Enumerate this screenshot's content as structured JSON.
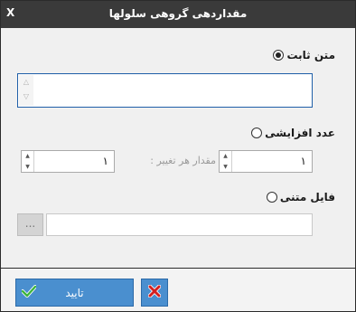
{
  "window": {
    "title": "مقداردهی گروهی سلولها",
    "close_label": "X"
  },
  "options": {
    "constant_text": {
      "label": "متن ثابت",
      "checked": true
    },
    "increment": {
      "label": "عدد افزایشی",
      "checked": false
    },
    "text_file": {
      "label": "فایل متنی",
      "checked": false
    }
  },
  "increment": {
    "start_value": "۱",
    "step_label": "مقدار هر تغییر :",
    "step_value": "۱"
  },
  "file": {
    "browse_label": "..."
  },
  "footer": {
    "ok_label": "تایید"
  },
  "colors": {
    "titlebar": "#3a3a3a",
    "accent": "#4a8fcf",
    "focus_border": "#1f5fa8"
  }
}
